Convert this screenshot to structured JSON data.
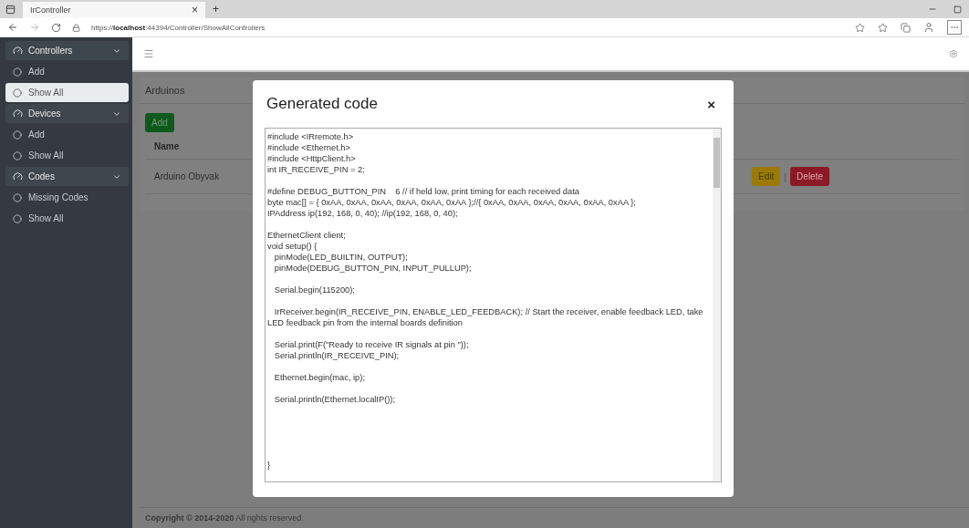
{
  "browser": {
    "tab_title": "IrController",
    "tab_close": "×",
    "new_tab": "+",
    "url": "https://**localhost**:44394/Controller/ShowAllControllers"
  },
  "sidebar": {
    "groups": [
      {
        "label": "Controllers",
        "expanded": true,
        "items": [
          {
            "label": "Add",
            "selected": false
          },
          {
            "label": "Show All",
            "selected": true
          }
        ]
      },
      {
        "label": "Devices",
        "expanded": true,
        "items": [
          {
            "label": "Add",
            "selected": false
          },
          {
            "label": "Show All",
            "selected": false
          }
        ]
      },
      {
        "label": "Codes",
        "expanded": true,
        "items": [
          {
            "label": "Missing Codes",
            "selected": false
          },
          {
            "label": "Show All",
            "selected": false
          }
        ]
      }
    ]
  },
  "page": {
    "title": "Arduinos",
    "add_button": "Add",
    "table": {
      "columns": [
        "Name"
      ],
      "rows": [
        {
          "name": "Arduino Obyvak",
          "separator": "|",
          "actions": [
            {
              "label": "Edit",
              "kind": "edit"
            },
            {
              "label": "Delete",
              "kind": "delete"
            }
          ]
        }
      ]
    }
  },
  "modal": {
    "title": "Generated code",
    "close": "×",
    "code": "#include <IRremote.h>\n#include <Ethernet.h>\n#include <HttpClient.h>\nint IR_RECEIVE_PIN = 2;\n\n#define DEBUG_BUTTON_PIN    6 // if held low, print timing for each received data\nbyte mac[] = { 0xAA, 0xAA, 0xAA, 0xAA, 0xAA, 0xAA };//{ 0xAA, 0xAA, 0xAA, 0xAA, 0xAA, 0xAA };\nIPAddress ip(192, 168, 0, 40); //ip(192, 168, 0, 40);\n\nEthernetClient client;\nvoid setup() {\n   pinMode(LED_BUILTIN, OUTPUT);\n   pinMode(DEBUG_BUTTON_PIN, INPUT_PULLUP);\n\n   Serial.begin(115200);\n\n   IrReceiver.begin(IR_RECEIVE_PIN, ENABLE_LED_FEEDBACK); // Start the receiver, enable feedback LED, take LED feedback pin from the internal boards definition\n\n   Serial.print(F(\"Ready to receive IR signals at pin \"));\n   Serial.println(IR_RECEIVE_PIN);\n\n   Ethernet.begin(mac, ip);\n\n   Serial.println(Ethernet.localIP());\n\n\n\n\n\n}"
  },
  "footer": "**Copyright © 2014-2020** All rights reserved."
}
